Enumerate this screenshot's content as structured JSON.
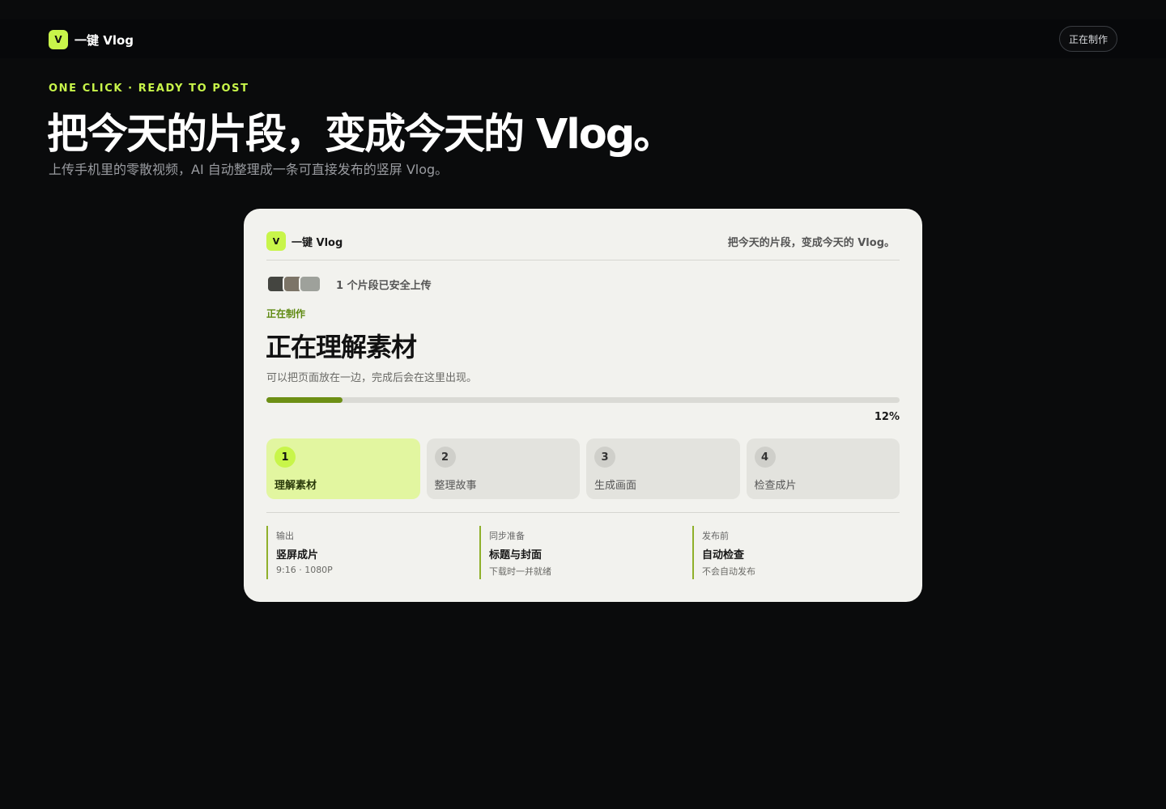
{
  "app": {
    "logo_letter": "V",
    "name": "一键 Vlog",
    "status": "正在制作"
  },
  "hero": {
    "eyebrow": "ONE CLICK · READY TO POST",
    "title": "把今天的片段，变成今天的 Vlog。",
    "subtitle": "上传手机里的零散视频，AI 自动整理成一条可直接发布的竖屏 Vlog。"
  },
  "card": {
    "brand_letter": "V",
    "brand_name": "一键 Vlog",
    "tagline": "把今天的片段，变成今天的 Vlog。",
    "clips_text": "1 个片段已安全上传",
    "status_label": "正在制作",
    "status_title": "正在理解素材",
    "status_desc": "可以把页面放在一边，完成后会在这里出现。",
    "progress_value": 12,
    "progress_text": "12%",
    "steps": [
      {
        "num": "1",
        "label": "理解素材"
      },
      {
        "num": "2",
        "label": "整理故事"
      },
      {
        "num": "3",
        "label": "生成画面"
      },
      {
        "num": "4",
        "label": "检查成片"
      }
    ],
    "outputs": [
      {
        "label": "输出",
        "title": "竖屏成片",
        "meta": "9:16 · 1080P"
      },
      {
        "label": "同步准备",
        "title": "标题与封面",
        "meta": "下载时一并就绪"
      },
      {
        "label": "发布前",
        "title": "自动检查",
        "meta": "不会自动发布"
      }
    ]
  },
  "colors": {
    "accent": "#c8f54a",
    "progress": "#6d8f15",
    "card_bg": "#f2f2ee",
    "page_bg": "#0a0b0c"
  }
}
